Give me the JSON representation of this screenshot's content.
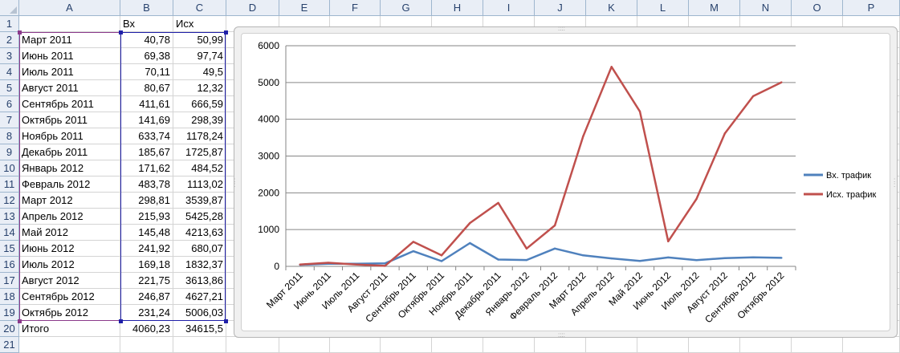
{
  "columns": [
    "A",
    "B",
    "C",
    "D",
    "E",
    "F",
    "G",
    "H",
    "I",
    "J",
    "K",
    "L",
    "M",
    "N",
    "O",
    "P"
  ],
  "rows": [
    "1",
    "2",
    "3",
    "4",
    "5",
    "6",
    "7",
    "8",
    "9",
    "10",
    "11",
    "12",
    "13",
    "14",
    "15",
    "16",
    "17",
    "18",
    "19",
    "20",
    "21"
  ],
  "header_row": {
    "a": "",
    "b": "Вх",
    "c": "Исх"
  },
  "table": [
    {
      "month": "Март 2011",
      "vx": "40,78",
      "isx": "50,99"
    },
    {
      "month": "Июнь 2011",
      "vx": "69,38",
      "isx": "97,74"
    },
    {
      "month": "Июль 2011",
      "vx": "70,11",
      "isx": "49,5"
    },
    {
      "month": "Август 2011",
      "vx": "80,67",
      "isx": "12,32"
    },
    {
      "month": "Сентябрь 2011",
      "vx": "411,61",
      "isx": "666,59"
    },
    {
      "month": "Октябрь 2011",
      "vx": "141,69",
      "isx": "298,39"
    },
    {
      "month": "Ноябрь 2011",
      "vx": "633,74",
      "isx": "1178,24"
    },
    {
      "month": "Декабрь 2011",
      "vx": "185,67",
      "isx": "1725,87"
    },
    {
      "month": "Январь 2012",
      "vx": "171,62",
      "isx": "484,52"
    },
    {
      "month": "Февраль 2012",
      "vx": "483,78",
      "isx": "1113,02"
    },
    {
      "month": "Март 2012",
      "vx": "298,81",
      "isx": "3539,87"
    },
    {
      "month": "Апрель 2012",
      "vx": "215,93",
      "isx": "5425,28"
    },
    {
      "month": "Май 2012",
      "vx": "145,48",
      "isx": "4213,63"
    },
    {
      "month": "Июнь 2012",
      "vx": "241,92",
      "isx": "680,07"
    },
    {
      "month": "Июль 2012",
      "vx": "169,18",
      "isx": "1832,37"
    },
    {
      "month": "Август 2012",
      "vx": "221,75",
      "isx": "3613,86"
    },
    {
      "month": "Сентябрь 2012",
      "vx": "246,87",
      "isx": "4627,21"
    },
    {
      "month": "Октябрь 2012",
      "vx": "231,24",
      "isx": "5006,03"
    }
  ],
  "total": {
    "label": "Итого",
    "vx": "4060,23",
    "isx": "34615,5"
  },
  "chart_data": {
    "type": "line",
    "categories": [
      "Март 2011",
      "Июнь 2011",
      "Июль 2011",
      "Август 2011",
      "Сентябрь 2011",
      "Октябрь 2011",
      "Ноябрь 2011",
      "Декабрь 2011",
      "Январь 2012",
      "Февраль 2012",
      "Март 2012",
      "Апрель 2012",
      "Май 2012",
      "Июнь 2012",
      "Июль 2012",
      "Август 2012",
      "Сентябрь 2012",
      "Октябрь 2012"
    ],
    "series": [
      {
        "name": "Вх. трафик",
        "color": "#4f81bd",
        "values": [
          40.78,
          69.38,
          70.11,
          80.67,
          411.61,
          141.69,
          633.74,
          185.67,
          171.62,
          483.78,
          298.81,
          215.93,
          145.48,
          241.92,
          169.18,
          221.75,
          246.87,
          231.24
        ]
      },
      {
        "name": "Исх. трафик",
        "color": "#c0504d",
        "values": [
          50.99,
          97.74,
          49.5,
          12.32,
          666.59,
          298.39,
          1178.24,
          1725.87,
          484.52,
          1113.02,
          3539.87,
          5425.28,
          4213.63,
          680.07,
          1832.37,
          3613.86,
          4627.21,
          5006.03
        ]
      }
    ],
    "yticks": [
      "0",
      "1000",
      "2000",
      "3000",
      "4000",
      "5000",
      "6000"
    ],
    "ylim": [
      0,
      6000
    ],
    "grid": true,
    "legend": "right"
  }
}
